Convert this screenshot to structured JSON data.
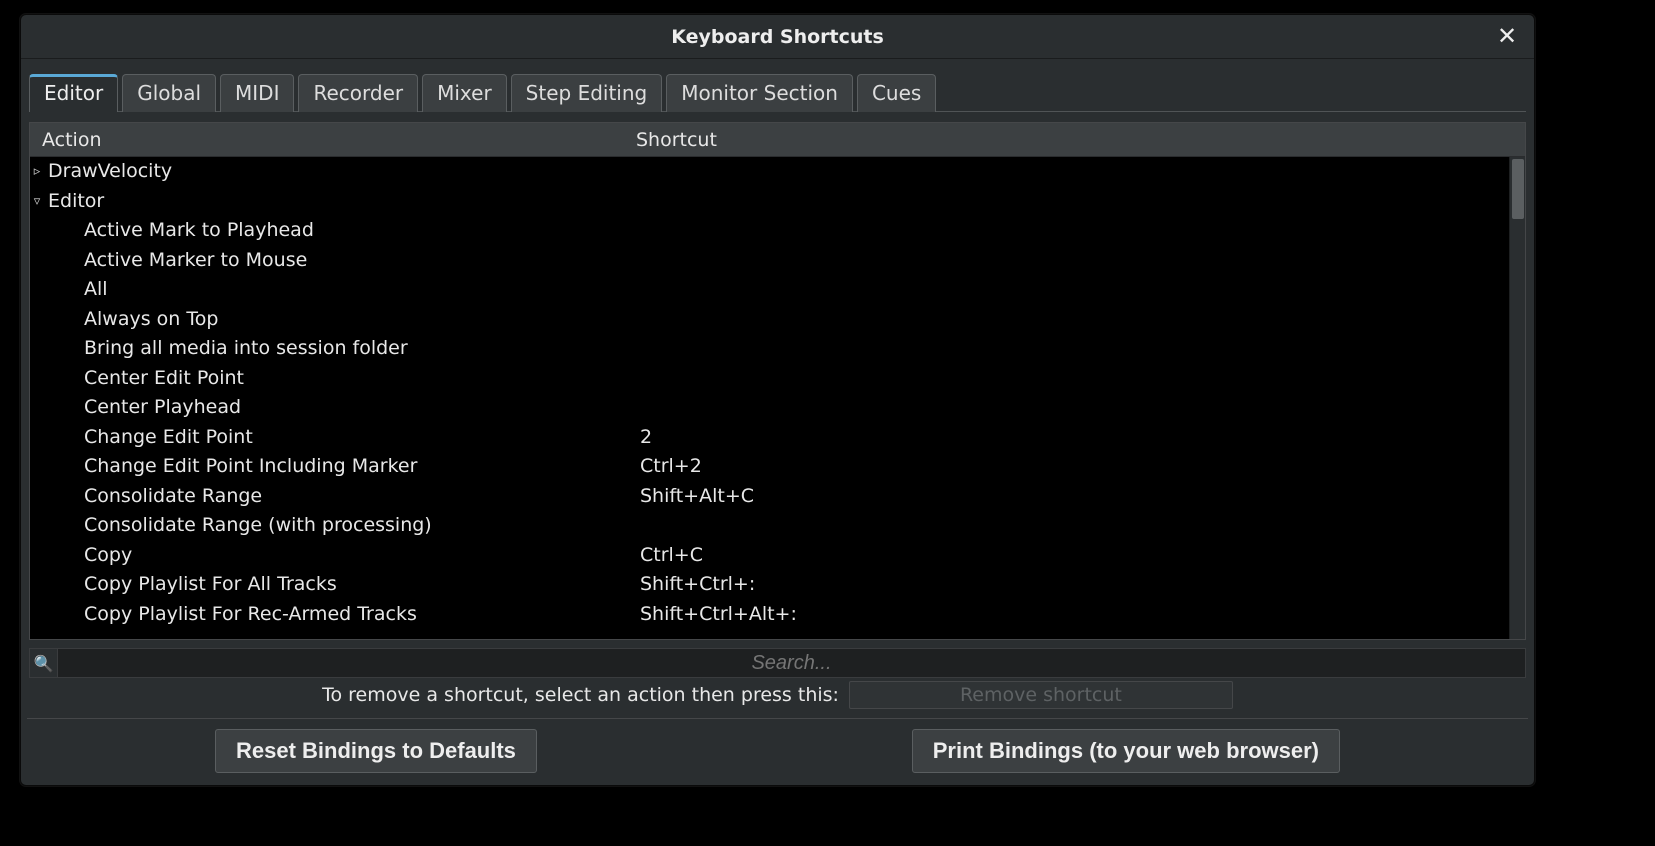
{
  "title": "Keyboard Shortcuts",
  "tabs": {
    "t0": "Editor",
    "t1": "Global",
    "t2": "MIDI",
    "t3": "Recorder",
    "t4": "Mixer",
    "t5": "Step Editing",
    "t6": "Monitor Section",
    "t7": "Cues"
  },
  "columns": {
    "action": "Action",
    "shortcut": "Shortcut"
  },
  "tree": {
    "g0": {
      "label": "DrawVelocity",
      "expanded": "▹"
    },
    "g1": {
      "label": "Editor",
      "expanded": "▿"
    },
    "r": [
      {
        "action": "Active Mark to Playhead",
        "shortcut": ""
      },
      {
        "action": "Active Marker to Mouse",
        "shortcut": ""
      },
      {
        "action": "All",
        "shortcut": ""
      },
      {
        "action": "Always on Top",
        "shortcut": ""
      },
      {
        "action": "Bring all media into session folder",
        "shortcut": ""
      },
      {
        "action": "Center Edit Point",
        "shortcut": ""
      },
      {
        "action": "Center Playhead",
        "shortcut": ""
      },
      {
        "action": "Change Edit Point",
        "shortcut": "2"
      },
      {
        "action": "Change Edit Point Including Marker",
        "shortcut": "Ctrl+2"
      },
      {
        "action": "Consolidate Range",
        "shortcut": "Shift+Alt+C"
      },
      {
        "action": "Consolidate Range (with processing)",
        "shortcut": ""
      },
      {
        "action": "Copy",
        "shortcut": "Ctrl+C"
      },
      {
        "action": "Copy Playlist For All Tracks",
        "shortcut": "Shift+Ctrl+:"
      },
      {
        "action": "Copy Playlist For Rec-Armed Tracks",
        "shortcut": "Shift+Ctrl+Alt+:"
      }
    ]
  },
  "search": {
    "placeholder": "Search..."
  },
  "remove": {
    "hint": "To remove a shortcut, select an action then press this:",
    "btn": "Remove shortcut"
  },
  "footer": {
    "reset": "Reset Bindings to Defaults",
    "print": "Print Bindings (to your web browser)"
  }
}
